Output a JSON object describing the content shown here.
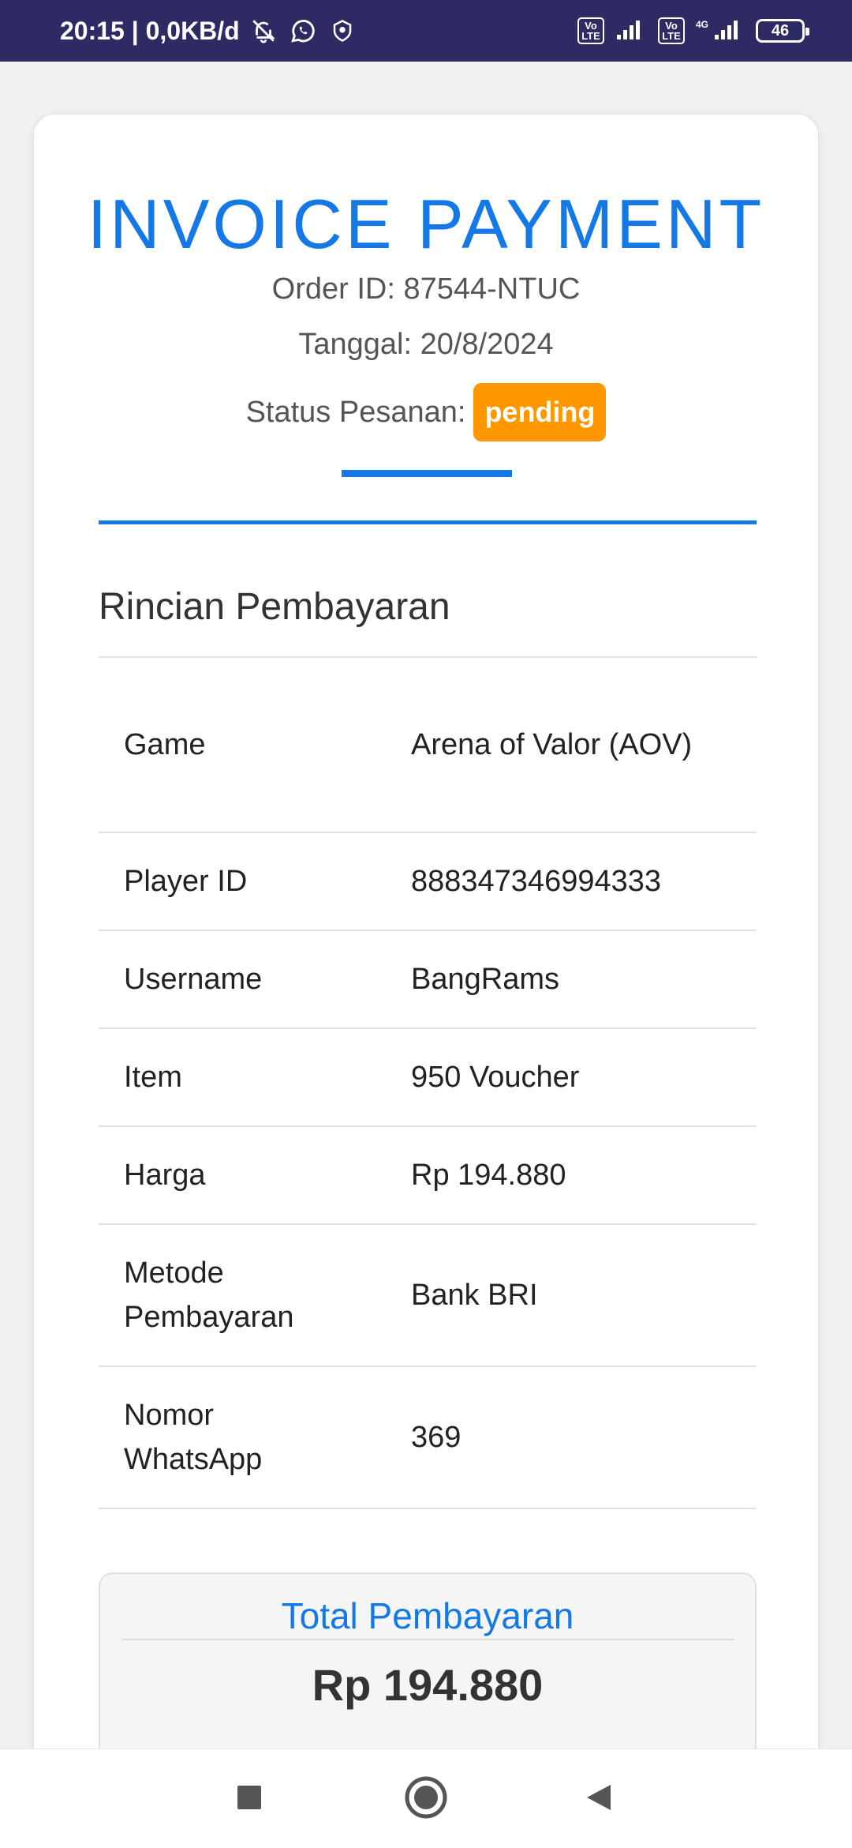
{
  "status_bar": {
    "time_info": "20:15 | 0,0KB/d",
    "volte1": "Vo LTE",
    "volte2": "Vo LTE",
    "network_label": "4G",
    "battery": "46"
  },
  "invoice": {
    "title": "INVOICE PAYMENT",
    "order_id": "Order ID: 87544-NTUC",
    "date": "Tanggal: 20/8/2024",
    "status_label": "Status Pesanan:",
    "status_value": "pending",
    "status_color": "#ff9800",
    "accent_color": "#1479e6"
  },
  "details": {
    "section_title": "Rincian Pembayaran",
    "rows": [
      {
        "label": "Game",
        "value": "Arena of Valor (AOV)"
      },
      {
        "label": "Player ID",
        "value": "888347346994333"
      },
      {
        "label": "Username",
        "value": "BangRams"
      },
      {
        "label": "Item",
        "value": "950 Voucher"
      },
      {
        "label": "Harga",
        "value": "Rp 194.880"
      },
      {
        "label": "Metode Pembayaran",
        "value": "Bank BRI"
      },
      {
        "label": "Nomor WhatsApp",
        "value": "369"
      }
    ]
  },
  "total": {
    "title": "Total Pembayaran",
    "amount": "Rp 194.880"
  },
  "nav": {
    "recents_icon": "square-icon",
    "home_icon": "circle-icon",
    "back_icon": "triangle-back-icon"
  }
}
